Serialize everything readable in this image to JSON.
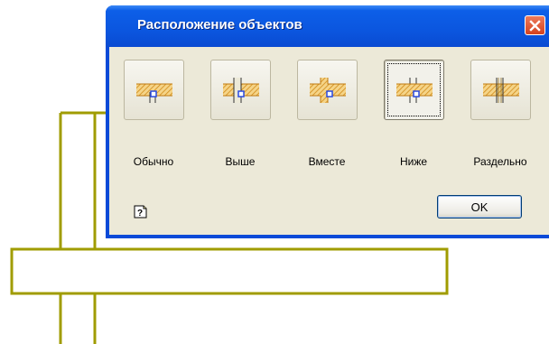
{
  "dialog": {
    "title": "Расположение объектов",
    "options": [
      {
        "label": "Обычно",
        "icon": "layout-normal-icon",
        "selected": false
      },
      {
        "label": "Выше",
        "icon": "layout-above-icon",
        "selected": false
      },
      {
        "label": "Вместе",
        "icon": "layout-together-icon",
        "selected": false
      },
      {
        "label": "Ниже",
        "icon": "layout-below-icon",
        "selected": true
      },
      {
        "label": "Раздельно",
        "icon": "layout-separate-icon",
        "selected": false
      }
    ],
    "ok_label": "OK",
    "help_icon": "help-icon",
    "close_icon": "close-icon"
  },
  "colors": {
    "titlebar": "#0b56df",
    "dialog_body": "#ece9d8",
    "drawing_lines": "#a09c00",
    "hatch": "#e8a830",
    "marker": "#2a4ae0"
  }
}
